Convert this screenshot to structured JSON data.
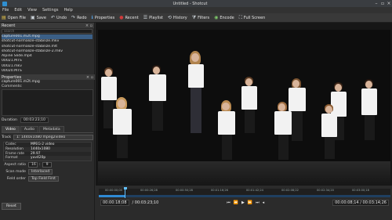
{
  "window": {
    "title": "Untitled - Shotcut"
  },
  "menu": [
    "File",
    "Edit",
    "View",
    "Settings",
    "Help"
  ],
  "toolbar": [
    {
      "label": "Open File",
      "icon": "folder-open-icon"
    },
    {
      "label": "Save",
      "icon": "save-icon"
    },
    {
      "label": "Undo",
      "icon": "undo-icon"
    },
    {
      "label": "Redo",
      "icon": "redo-icon"
    },
    {
      "label": "Properties",
      "icon": "info-icon"
    },
    {
      "label": "Recent",
      "icon": "recent-icon"
    },
    {
      "label": "Playlist",
      "icon": "playlist-icon"
    },
    {
      "label": "History",
      "icon": "history-icon"
    },
    {
      "label": "Filters",
      "icon": "filter-icon"
    },
    {
      "label": "Encode",
      "icon": "encode-icon"
    },
    {
      "label": "Full Screen",
      "icon": "fullscreen-icon"
    }
  ],
  "recent": {
    "title": "Recent",
    "search_placeholder": "search",
    "items": [
      "capture001.m2t.mpg",
      "shotcut-normalize-stabilize.mkv",
      "shotcut-normalize-stabilize.mlt",
      "shotcut-normalize-stabilize-2.mkv",
      "Alpine Slide.mp4",
      "00021.MTS",
      "00021.mkv",
      "00020.MTS"
    ],
    "selected_index": 0
  },
  "properties": {
    "title": "Properties",
    "file": "capture001.m2t.mpg",
    "comments_label": "Comments:",
    "duration_label": "Duration",
    "duration_value": "00:03:23;10",
    "tabs": [
      "Video",
      "Audio",
      "Metadata"
    ],
    "track_label": "Track",
    "track_value": "1: 1440x1080 mpeg2video",
    "info": [
      {
        "k": "Codec",
        "v": "MPEG-2 video"
      },
      {
        "k": "Resolution",
        "v": "1440x1080"
      },
      {
        "k": "Frame rate",
        "v": "29.97"
      },
      {
        "k": "Format",
        "v": "yuv420p"
      }
    ],
    "aspect_label": "Aspect ratio",
    "aspect_w": "16",
    "aspect_h": "9",
    "scan_label": "Scan mode",
    "scan_value": "Interlaced",
    "field_label": "Field order",
    "field_value": "Top Field First",
    "reset_label": "Reset"
  },
  "timeline": {
    "ticks": [
      "00:00:00;00",
      "00:00:26;28",
      "00:00:50;28",
      "00:01:16;26",
      "00:01:42;24",
      "00:02:08;22",
      "00:02:34;20",
      "00:03:00;18"
    ],
    "position": "00:00:18;08",
    "duration": "/ 00:03:23;10",
    "in_out": "00:00:08;14 / 00:03:14;26",
    "progress": 0.09
  },
  "colors": {
    "accent": "#2f8ad4",
    "selection": "#3b5f86"
  }
}
